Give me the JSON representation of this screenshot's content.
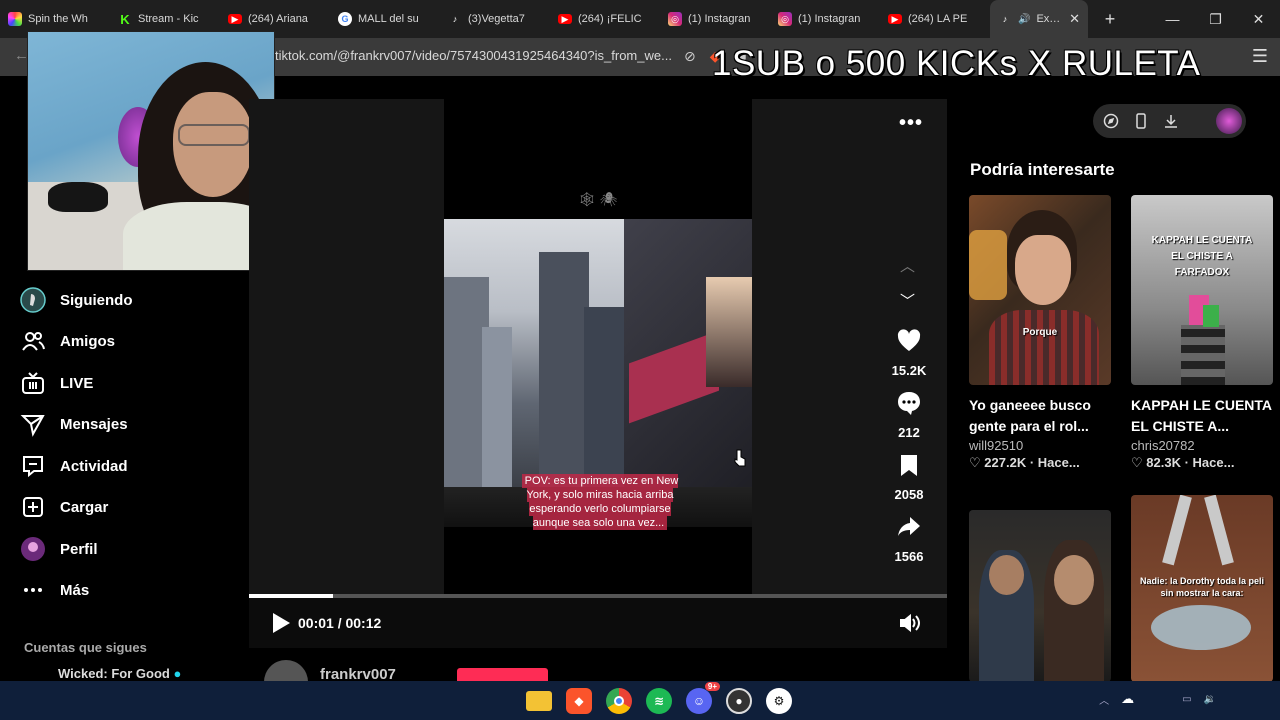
{
  "browser": {
    "tabs": [
      {
        "title": "Spin the Wh",
        "icon": "spin-wheel-icon",
        "color": "#f4a"
      },
      {
        "title": "Stream - Kic",
        "icon": "kick-icon",
        "color": "#53fc18"
      },
      {
        "title": "(264) Ariana",
        "icon": "youtube-icon",
        "color": "#ff0000"
      },
      {
        "title": "MALL del su",
        "icon": "google-icon",
        "color": "#4285f4"
      },
      {
        "title": "(3)Vegetta7",
        "icon": "tiktok-icon",
        "color": "#111111"
      },
      {
        "title": "(264) ¡FELIC",
        "icon": "youtube-icon",
        "color": "#ff0000"
      },
      {
        "title": "(1) Instagran",
        "icon": "instagram-icon",
        "color": "#d6249f"
      },
      {
        "title": "(1) Instagran",
        "icon": "instagram-icon",
        "color": "#d6249f"
      },
      {
        "title": "(264) LA PE",
        "icon": "youtube-icon",
        "color": "#ff0000"
      },
      {
        "title": "Explo",
        "icon": "tiktok-icon",
        "color": "#111111",
        "active": true
      }
    ],
    "url": "tiktok.com/@frankrv007/video/7574300431925464340?is_from_we..."
  },
  "stream_overlay": "1SUB o 500 KICKs X RULETA",
  "sidebar": {
    "items": [
      {
        "label": "Siguiendo",
        "icon": "following-avatar-icon"
      },
      {
        "label": "Amigos",
        "icon": "friends-icon"
      },
      {
        "label": "LIVE",
        "icon": "live-icon"
      },
      {
        "label": "Mensajes",
        "icon": "messages-icon"
      },
      {
        "label": "Actividad",
        "icon": "activity-icon"
      },
      {
        "label": "Cargar",
        "icon": "upload-icon"
      },
      {
        "label": "Perfil",
        "icon": "profile-avatar-icon"
      },
      {
        "label": "Más",
        "icon": "more-icon"
      }
    ],
    "following_title": "Cuentas que sigues",
    "following_first": "Wicked: For Good"
  },
  "video": {
    "caption": "POV: es tu primera vez en New York, y solo miras hacia arriba esperando verlo columpiarse aunque sea solo una vez...",
    "likes": "15.2K",
    "comments": "212",
    "saves": "2058",
    "shares": "1566",
    "time": "00:01 / 00:12",
    "progress_fraction": 0.12,
    "author": "frankrv007"
  },
  "recommendations": {
    "title": "Podría interesarte",
    "cards": [
      {
        "caption": "Yo ganeeee busco gente para el rol...",
        "author": "will92510",
        "views": "227.2K",
        "time": "Hace...",
        "thumb_text": "Porque"
      },
      {
        "caption": "KAPPAH LE CUENTA EL CHISTE A...",
        "author": "chris20782",
        "views": "82.3K",
        "time": "Hace...",
        "thumb_text": "KAPPAH LE CUENTA EL CHISTE A FARFADOX"
      },
      {
        "caption": "",
        "author": "",
        "views": "",
        "time": "",
        "thumb_text": ""
      },
      {
        "caption": "",
        "author": "",
        "views": "",
        "time": "",
        "thumb_text": "Nadie: la Dorothy toda la peli sin mostrar la cara:"
      }
    ]
  },
  "taskbar": {
    "discord_badge": "9+"
  }
}
